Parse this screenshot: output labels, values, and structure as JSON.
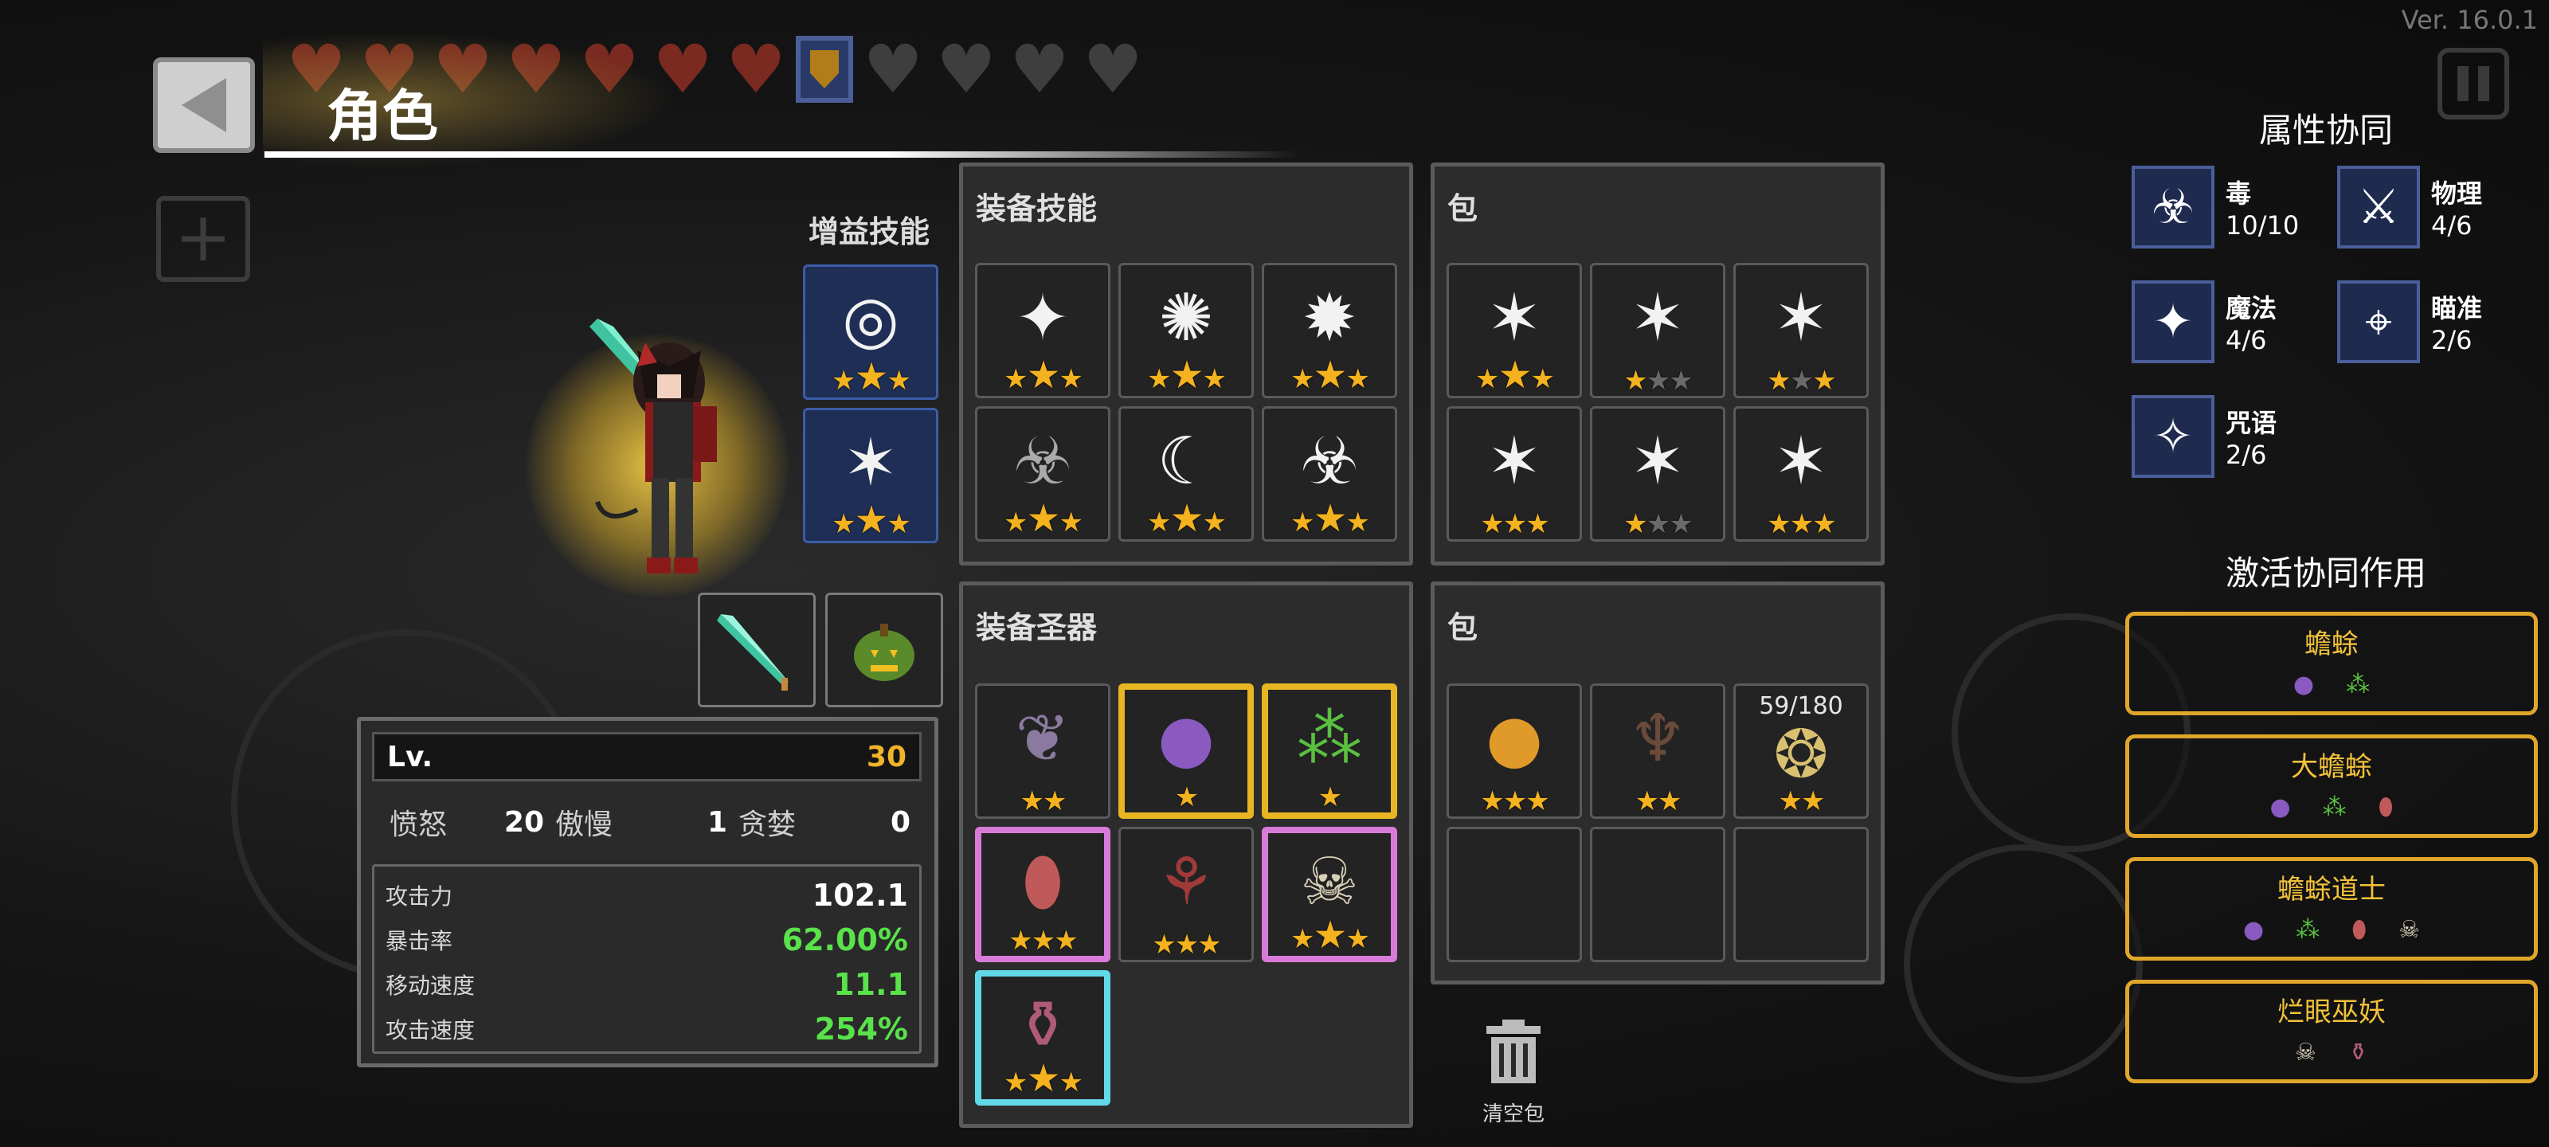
{
  "version": "Ver. 16.0.1",
  "page_title": "角色",
  "hud": {
    "hearts_full": 7,
    "hearts_empty": 4,
    "shield_count": 1
  },
  "buff_skills": {
    "title": "增益技能",
    "slots": [
      {
        "icon": "vortex-icon",
        "stars": 3
      },
      {
        "icon": "slash-icon",
        "stars": 3
      }
    ]
  },
  "equip_slots": [
    {
      "icon": "scythe-icon"
    },
    {
      "icon": "pumpkin-icon"
    }
  ],
  "equipped_skills": {
    "title": "装备技能",
    "slots": [
      {
        "icon": "bone-icon",
        "stars": 3,
        "filled": 3
      },
      {
        "icon": "skull-burst-icon",
        "stars": 3,
        "filled": 3
      },
      {
        "icon": "burst-icon",
        "stars": 3,
        "filled": 3
      },
      {
        "icon": "biohazard-burst-icon",
        "stars": 3,
        "filled": 3
      },
      {
        "icon": "crescent-icon",
        "stars": 3,
        "filled": 3
      },
      {
        "icon": "biohazard-icon",
        "stars": 3,
        "filled": 3
      }
    ]
  },
  "skill_bag": {
    "title": "包",
    "slots": [
      {
        "icon": "slash-icon",
        "stars": 3,
        "filled": 3
      },
      {
        "icon": "slash-icon",
        "stars": 3,
        "filled": 1
      },
      {
        "icon": "slash-icon",
        "stars": 3,
        "filled": 2
      },
      {
        "icon": "slash-icon",
        "stars": 3,
        "filled": 3
      },
      {
        "icon": "slash-icon",
        "stars": 3,
        "filled": 1
      },
      {
        "icon": "slash-icon",
        "stars": 3,
        "filled": 3
      }
    ]
  },
  "equipped_relics": {
    "title": "装备圣器",
    "slots": [
      {
        "icon": "feather-icon",
        "stars": 2,
        "border": "none"
      },
      {
        "icon": "toad-icon",
        "stars": 1,
        "border": "gold"
      },
      {
        "icon": "spore-icon",
        "stars": 1,
        "border": "gold"
      },
      {
        "icon": "egg-icon",
        "stars": 3,
        "border": "pink"
      },
      {
        "icon": "flower-icon",
        "stars": 3,
        "border": "none"
      },
      {
        "icon": "skull-icon",
        "stars": 3,
        "border": "pink"
      },
      {
        "icon": "potion-icon",
        "stars": 2,
        "border": "cyan"
      }
    ]
  },
  "relic_bag": {
    "title": "包",
    "slots": [
      {
        "icon": "coin-icon",
        "stars": 3,
        "counter": ""
      },
      {
        "icon": "doll-icon",
        "stars": 2,
        "counter": ""
      },
      {
        "icon": "nest-eggs-icon",
        "stars": 2,
        "counter": "59/180"
      },
      {
        "icon": "",
        "stars": 0,
        "counter": ""
      },
      {
        "icon": "",
        "stars": 0,
        "counter": ""
      },
      {
        "icon": "",
        "stars": 0,
        "counter": ""
      }
    ]
  },
  "trash": {
    "label": "清空包"
  },
  "stats": {
    "lv_label": "Lv.",
    "lv_value": "30",
    "sins": [
      {
        "name": "愤怒",
        "value": "20"
      },
      {
        "name": "傲慢",
        "value": "1"
      },
      {
        "name": "贪婪",
        "value": "0"
      }
    ],
    "lines": [
      {
        "name": "攻击力",
        "value": "102.1",
        "color": "white"
      },
      {
        "name": "暴击率",
        "value": "62.00%",
        "color": "green"
      },
      {
        "name": "移动速度",
        "value": "11.1",
        "color": "green"
      },
      {
        "name": "攻击速度",
        "value": "254%",
        "color": "green"
      }
    ]
  },
  "attributes": {
    "title": "属性协同",
    "items": [
      {
        "icon": "biohazard-icon",
        "name": "毒",
        "value": "10/10"
      },
      {
        "icon": "sword-icon",
        "name": "物理",
        "value": "4/6"
      },
      {
        "icon": "star4-icon",
        "name": "魔法",
        "value": "4/6"
      },
      {
        "icon": "crosshair-icon",
        "name": "瞄准",
        "value": "2/6"
      },
      {
        "icon": "orbit-icon",
        "name": "咒语",
        "value": "2/6"
      }
    ]
  },
  "synergies": {
    "title": "激活协同作用",
    "items": [
      {
        "name": "蟾蜍",
        "icons": [
          "toad-icon",
          "spore-icon"
        ]
      },
      {
        "name": "大蟾蜍",
        "icons": [
          "toad-icon",
          "spore-icon",
          "egg-icon"
        ]
      },
      {
        "name": "蟾蜍道士",
        "icons": [
          "toad-icon",
          "spore-icon",
          "egg-icon",
          "skull-icon"
        ]
      },
      {
        "name": "烂眼巫妖",
        "icons": [
          "skull-icon",
          "potion-icon"
        ]
      }
    ]
  },
  "colors": {
    "star": "#f3b21e",
    "gold_border": "#e8b523",
    "pink_border": "#d87ad8",
    "cyan_border": "#62d8e8",
    "green_value": "#59e24a",
    "level": "#f0b429"
  }
}
